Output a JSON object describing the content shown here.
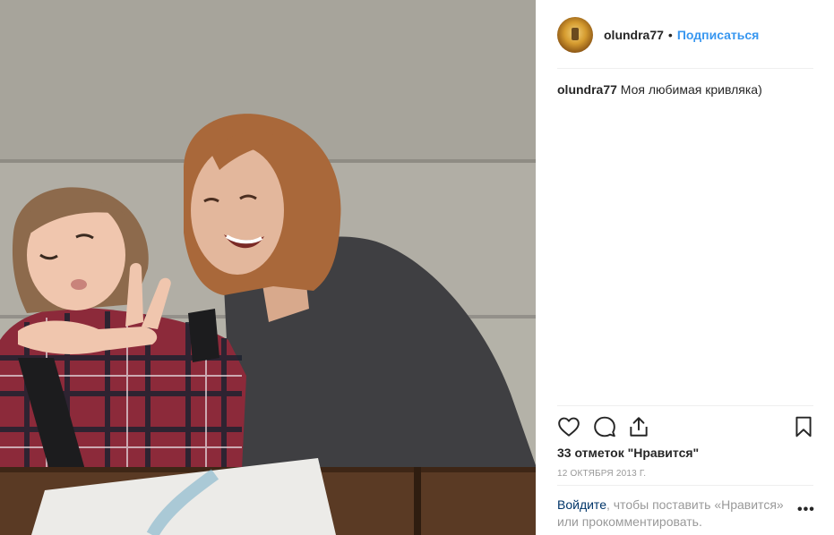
{
  "post": {
    "username": "olundra77",
    "separator": "•",
    "follow_label": "Подписаться",
    "caption_user": "olundra77",
    "caption_text": "Моя любимая кривляка)",
    "likes": "33 отметок \"Нравится\"",
    "date": "12 ОКТЯБРЯ 2013 Г.",
    "login_link": "Войдите",
    "login_text_1": ", чтобы поставить «Нравится»",
    "login_text_2": "или прокомментировать.",
    "more_label": "•••"
  },
  "icons": {
    "like": "heart-icon",
    "comment": "comment-bubble-icon",
    "share": "share-icon",
    "save": "bookmark-icon",
    "more": "more-options-icon"
  },
  "colors": {
    "link_blue": "#3897f0",
    "login_dark_blue": "#003569",
    "muted_text": "#999999",
    "divider": "#efefef"
  }
}
